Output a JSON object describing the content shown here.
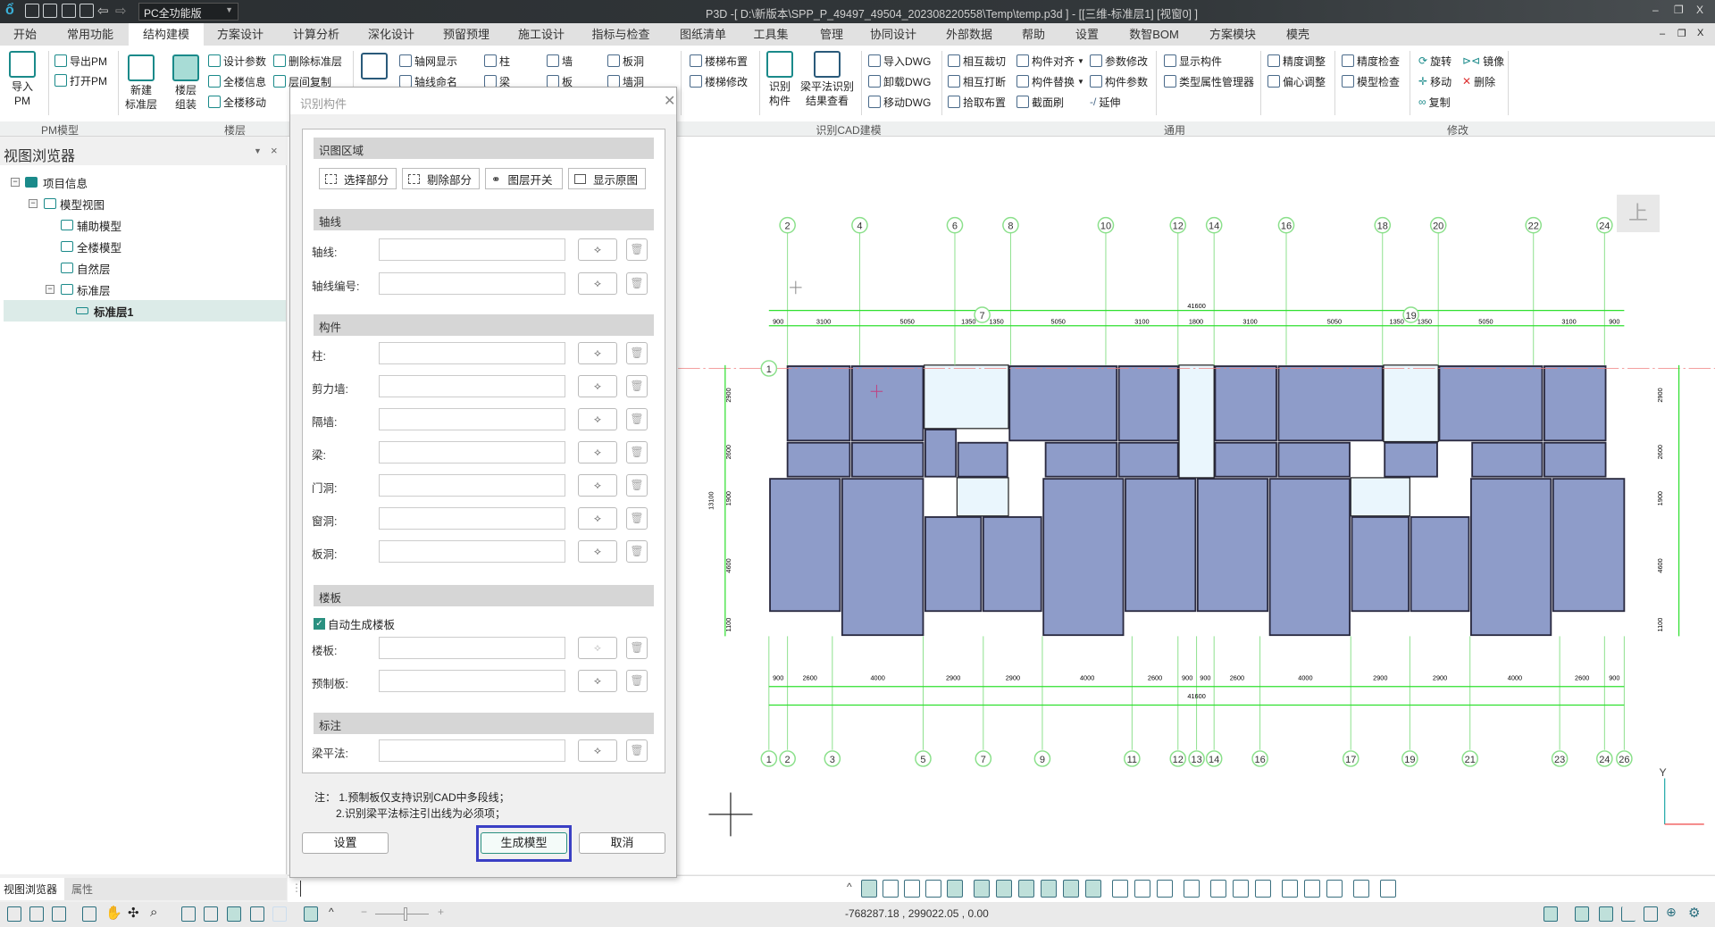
{
  "titlebar": {
    "edition": "PC全功能版",
    "title": "P3D -[ D:\\新版本\\SPP_P_49497_49504_202308220558\\Temp\\temp.p3d ] - [[三维-标准层1]  [视窗0]  ]",
    "minimize": "–",
    "restore": "❐",
    "close": "X"
  },
  "menu_tabs": [
    "开始",
    "常用功能",
    "结构建模",
    "方案设计",
    "计算分析",
    "深化设计",
    "预留预埋",
    "施工设计",
    "指标与检查",
    "图纸清单",
    "工具集",
    "管理",
    "协同设计",
    "外部数据",
    "帮助",
    "设置",
    "数智BOM",
    "方案模块",
    "模壳"
  ],
  "active_tab": "结构建模",
  "ribbon": {
    "import_pm": "导入\nPM",
    "export_pm": "导出PM",
    "open_pm": "打开PM",
    "new_std_floor": "新建\n标准层",
    "floor_assembly": "楼层\n组装",
    "design_params": "设计参数",
    "building_info": "全楼信息",
    "building_move": "全楼移动",
    "delete_std_floor": "删除标准层",
    "copy_between_floors": "层间复制",
    "axis_display": "轴网显示",
    "axis_naming": "轴线命名",
    "column": "柱",
    "beam": "梁",
    "wall": "墙",
    "slab": "板",
    "slab_hole": "板洞",
    "wall_hole": "墙洞",
    "stair_layout": "楼梯布置",
    "stair_modify": "楼梯修改",
    "recognize": "识别\n构件",
    "beam_result": "梁平法识别\n结果查看",
    "import_dwg": "导入DWG",
    "unload_dwg": "卸载DWG",
    "move_dwg": "移动DWG",
    "mutual_trim": "相互裁切",
    "mutual_break": "相互打断",
    "pick_layout": "拾取布置",
    "align": "构件对齐",
    "replace": "构件替换",
    "section_brush": "截面刷",
    "param_modify": "参数修改",
    "member_params": "构件参数",
    "extend": "延伸",
    "show_members": "显示构件",
    "type_prop_mgr": "类型属性管理器",
    "precision_adjust": "精度调整",
    "eccentric_adjust": "偏心调整",
    "precision_check": "精度检查",
    "model_check": "模型检查",
    "rotate": "旋转",
    "mirror": "镜像",
    "move": "移动",
    "delete": "删除",
    "copy": "复制",
    "groups": {
      "pm": "PM模型",
      "floor": "楼层",
      "cad": "识别CAD建模",
      "general": "通用",
      "modify": "修改"
    }
  },
  "view_browser": {
    "title": "视图浏览器",
    "tree": [
      "项目信息",
      "模型视图",
      "辅助模型",
      "全楼模型",
      "自然层",
      "标准层",
      "标准层1"
    ],
    "selected": "标准层1",
    "bottom_tabs": [
      "视图浏览器",
      "属性"
    ]
  },
  "dialog": {
    "title": "识别构件",
    "region_header": "识图区域",
    "region_buttons": [
      "选择部分",
      "剔除部分",
      "图层开关",
      "显示原图"
    ],
    "axis_header": "轴线",
    "axis_rows": [
      "轴线:",
      "轴线编号:"
    ],
    "member_header": "构件",
    "member_rows": [
      "柱:",
      "剪力墙:",
      "隔墙:",
      "梁:",
      "门洞:",
      "窗洞:",
      "板洞:"
    ],
    "slab_header": "楼板",
    "auto_slab_label": "自动生成楼板",
    "auto_slab_checked": true,
    "slab_rows": [
      "楼板:",
      "预制板:"
    ],
    "annotation_header": "标注",
    "annotation_rows": [
      "梁平法:"
    ],
    "notes": [
      "注：  1.预制板仅支持识别CAD中多段线；",
      "2.识别梁平法标注引出线为必须项；"
    ],
    "settings": "设置",
    "generate": "生成模型",
    "cancel": "取消"
  },
  "drawing": {
    "top_axes": [
      "2",
      "4",
      "6",
      "8",
      "10",
      "12",
      "14",
      "16",
      "18",
      "20",
      "22",
      "24"
    ],
    "mid_axes": [
      "7",
      "19"
    ],
    "left_axis": "1",
    "bottom_axes": [
      "1",
      "2",
      "3",
      "5",
      "7",
      "9",
      "11",
      "12",
      "13",
      "14",
      "16",
      "17",
      "19",
      "21",
      "23",
      "24",
      "26"
    ],
    "top_dims": [
      "900",
      "3100",
      "5050",
      "1350",
      "1350",
      "5050",
      "3100",
      "1800",
      "3100",
      "5050",
      "1350",
      "1350",
      "5050",
      "3100",
      "900"
    ],
    "top_total": "41600",
    "bottom_dims": [
      "900",
      "2600",
      "4000",
      "2900",
      "2900",
      "4000",
      "2600",
      "900",
      "900",
      "2600",
      "4000",
      "2900",
      "2900",
      "4000",
      "2600",
      "900"
    ],
    "bottom_total": "41600",
    "side_dims": [
      "2900",
      "2600",
      "1900",
      "4600",
      "1100"
    ],
    "side_total": "13100",
    "view_cube": "上",
    "axis_label_y": "Y"
  },
  "status": {
    "coordinates": "-768287.18 , 299022.05 , 0.00"
  },
  "colors": {
    "accent": "#1a8a8a",
    "grid": "#22dd22",
    "slab": "#8e9cc9",
    "highlight": "#3a3fc4"
  }
}
